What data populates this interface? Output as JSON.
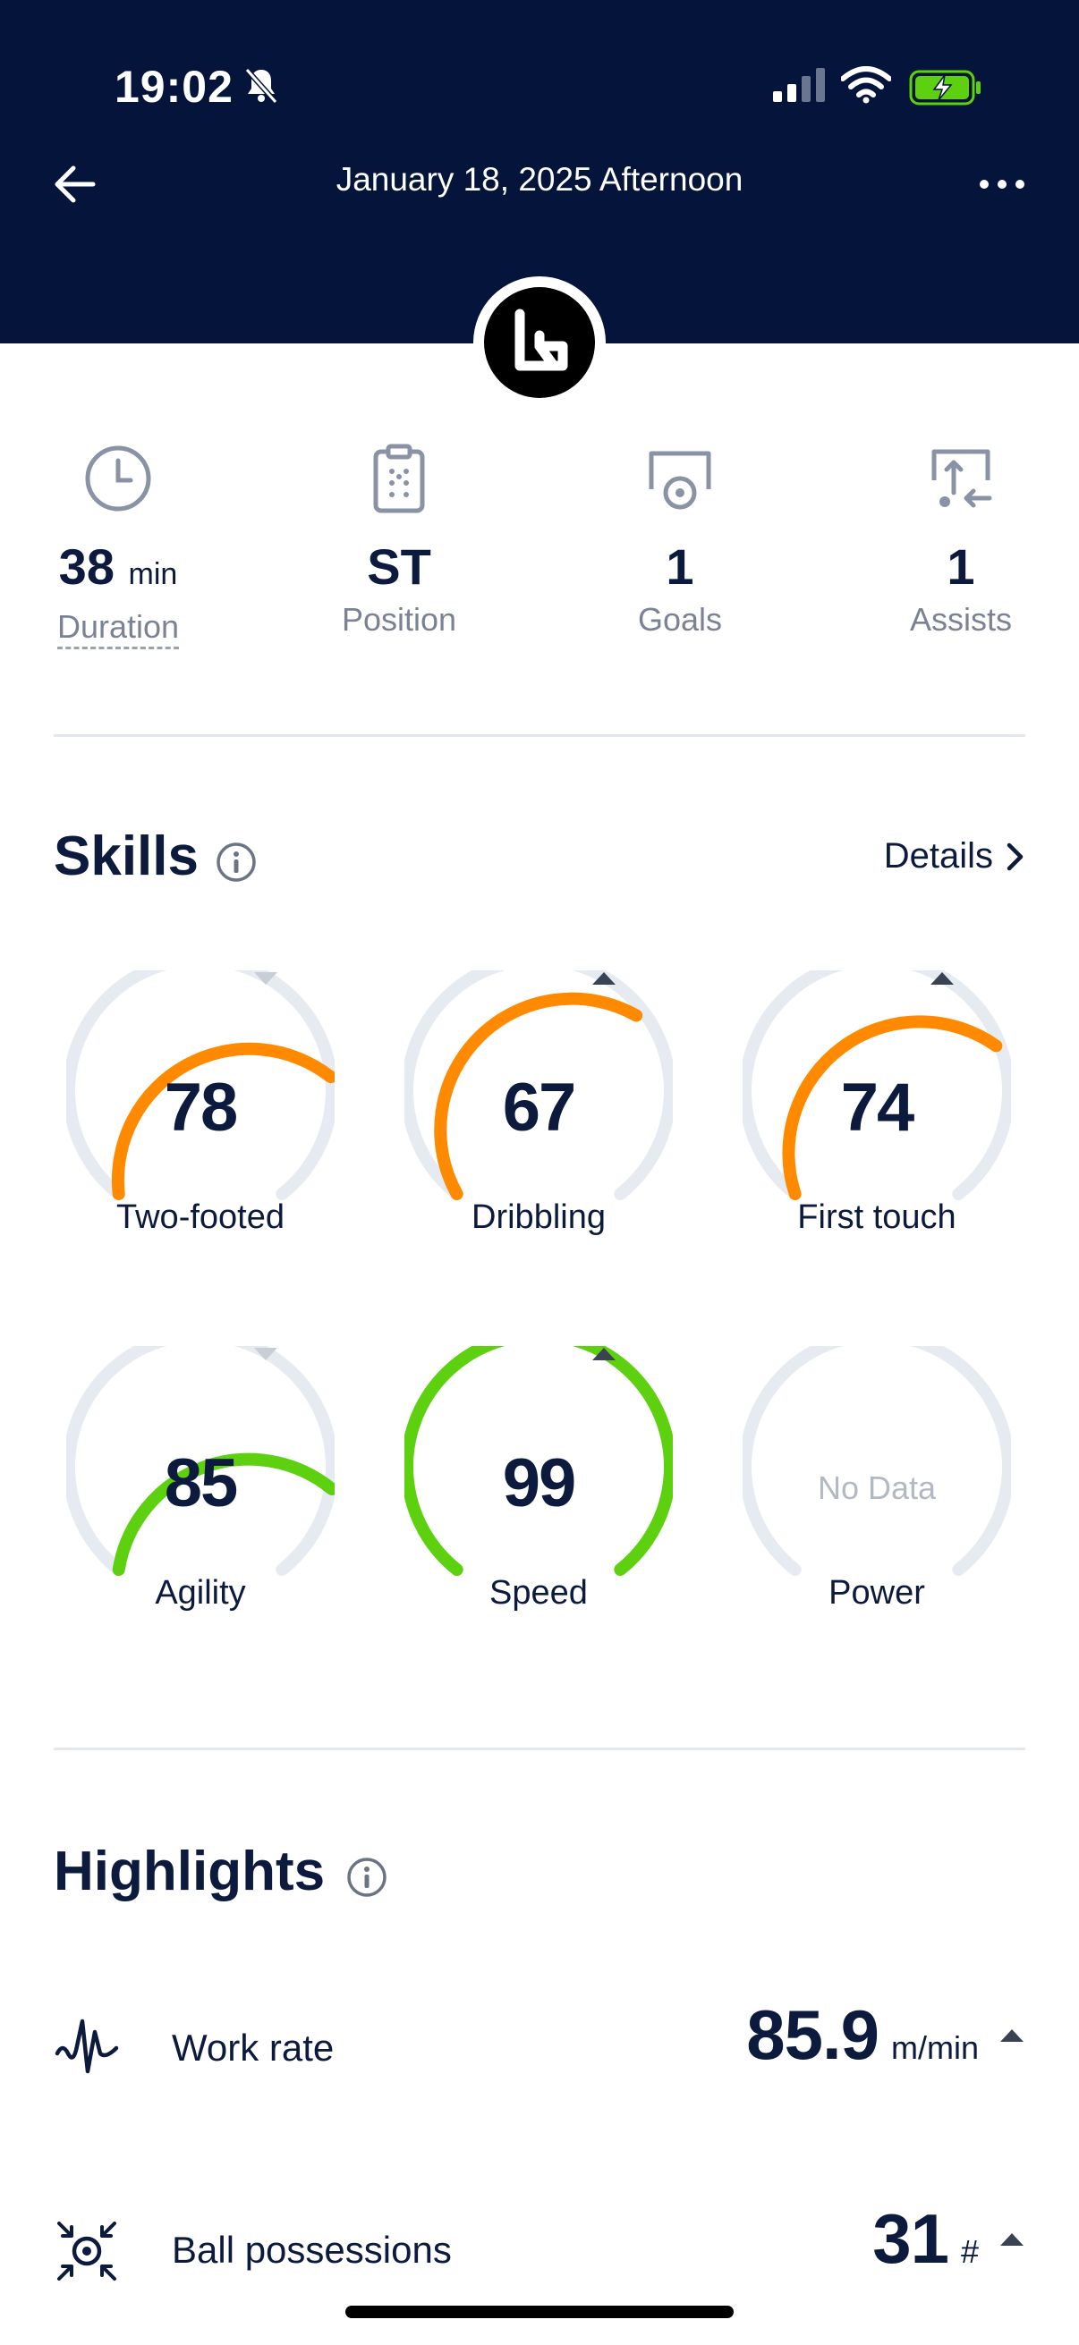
{
  "status_bar": {
    "time": "19:02"
  },
  "header": {
    "title": "January 18, 2025 Afternoon"
  },
  "stats": [
    {
      "value": "38",
      "unit": "min",
      "label": "Duration",
      "icon": "clock-icon"
    },
    {
      "value": "ST",
      "unit": "",
      "label": "Position",
      "icon": "clipboard-icon"
    },
    {
      "value": "1",
      "unit": "",
      "label": "Goals",
      "icon": "goal-icon"
    },
    {
      "value": "1",
      "unit": "",
      "label": "Assists",
      "icon": "assist-icon"
    }
  ],
  "skills": {
    "title": "Skills",
    "details_label": "Details",
    "items": [
      {
        "name": "Two-footed",
        "value": "78",
        "trend": "down",
        "color": "#ff8a00"
      },
      {
        "name": "Dribbling",
        "value": "67",
        "trend": "up",
        "color": "#ff8a00"
      },
      {
        "name": "First touch",
        "value": "74",
        "trend": "up",
        "color": "#ff8a00"
      },
      {
        "name": "Agility",
        "value": "85",
        "trend": "down",
        "color": "#5dd10f"
      },
      {
        "name": "Speed",
        "value": "99",
        "trend": "up",
        "color": "#5dd10f"
      },
      {
        "name": "Power",
        "value": "No Data",
        "trend": "none",
        "color": "#e5ebf0"
      }
    ]
  },
  "highlights": {
    "title": "Highlights",
    "items": [
      {
        "label": "Work rate",
        "value": "85.9",
        "unit": "m/min",
        "trend": "up",
        "icon": "work-rate-icon"
      },
      {
        "label": "Ball possessions",
        "value": "31",
        "unit": "#",
        "trend": "up",
        "icon": "ball-possession-icon"
      }
    ]
  }
}
